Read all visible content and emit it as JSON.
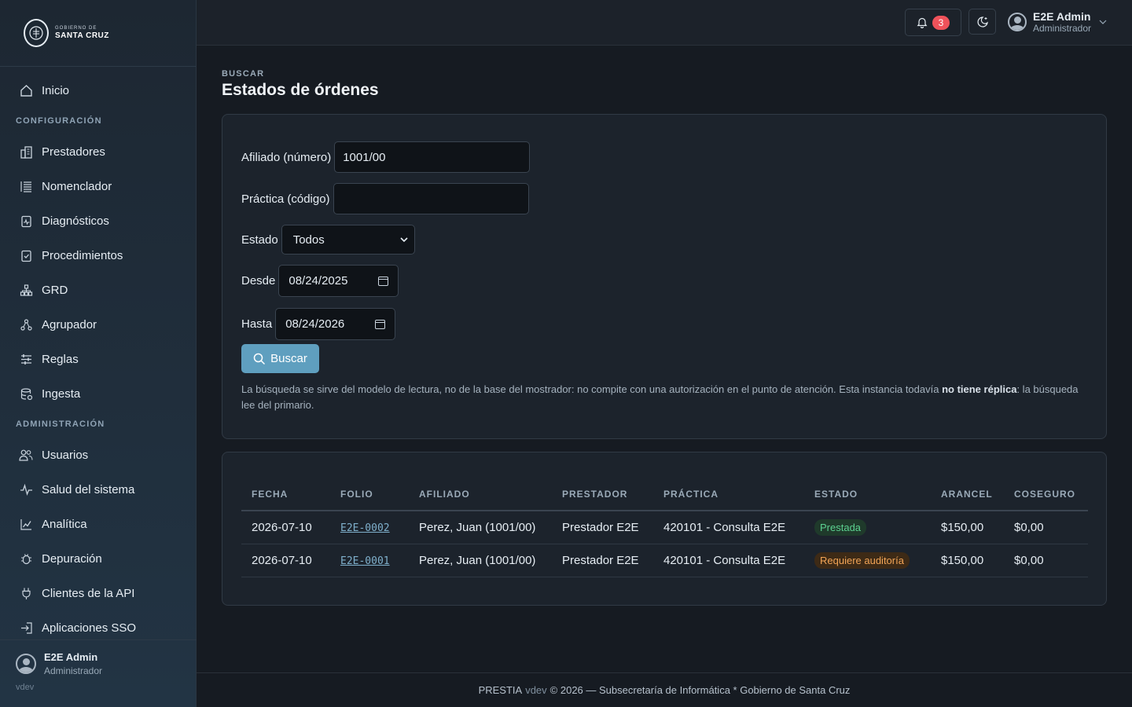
{
  "brand": {
    "logo_small": "GOBIERNO DE",
    "logo_big": "SANTA CRUZ"
  },
  "sidebar": {
    "home": "Inicio",
    "section_config": "CONFIGURACIÓN",
    "config_items": [
      {
        "label": "Prestadores",
        "icon": "building-icon"
      },
      {
        "label": "Nomenclador",
        "icon": "list-icon"
      },
      {
        "label": "Diagnósticos",
        "icon": "clipboard-pulse-icon"
      },
      {
        "label": "Procedimientos",
        "icon": "clipboard-check-icon"
      },
      {
        "label": "GRD",
        "icon": "hierarchy-icon"
      },
      {
        "label": "Agrupador",
        "icon": "nodes-icon"
      },
      {
        "label": "Reglas",
        "icon": "sliders-icon"
      },
      {
        "label": "Ingesta",
        "icon": "database-icon"
      }
    ],
    "section_admin": "ADMINISTRACIÓN",
    "admin_items": [
      {
        "label": "Usuarios",
        "icon": "users-icon"
      },
      {
        "label": "Salud del sistema",
        "icon": "activity-icon"
      },
      {
        "label": "Analítica",
        "icon": "chart-line-icon"
      },
      {
        "label": "Depuración",
        "icon": "bug-icon"
      },
      {
        "label": "Clientes de la API",
        "icon": "plug-icon"
      },
      {
        "label": "Aplicaciones SSO",
        "icon": "login-icon"
      }
    ],
    "user_name": "E2E Admin",
    "user_role": "Administrador",
    "version": "vdev"
  },
  "topbar": {
    "notification_count": "3",
    "user_name": "E2E Admin",
    "user_role": "Administrador"
  },
  "page": {
    "eyebrow": "BUSCAR",
    "title": "Estados de órdenes"
  },
  "form": {
    "afiliado_label": "Afiliado (número)",
    "afiliado_value": "1001/00",
    "practica_label": "Práctica (código)",
    "practica_value": "",
    "estado_label": "Estado",
    "estado_value": "Todos",
    "desde_label": "Desde",
    "desde_value": "08/24/2025",
    "hasta_label": "Hasta",
    "hasta_value": "08/24/2026",
    "buscar_label": "Buscar",
    "help_text_1": "La búsqueda se sirve del modelo de lectura, no de la base del mostrador: no compite con una autorización en el punto de atención. Esta instancia todavía ",
    "help_strong": "no tiene réplica",
    "help_text_2": ": la búsqueda lee del primario."
  },
  "table": {
    "columns": [
      "FECHA",
      "FOLIO",
      "AFILIADO",
      "PRESTADOR",
      "PRÁCTICA",
      "ESTADO",
      "ARANCEL",
      "COSEGURO"
    ],
    "rows": [
      {
        "fecha": "2026-07-10",
        "folio": "E2E-0002",
        "afiliado": "Perez, Juan (1001/00)",
        "prestador": "Prestador E2E",
        "practica": "420101 - Consulta E2E",
        "estado": "Prestada",
        "arancel": "$150,00",
        "coseguro": "$0,00"
      },
      {
        "fecha": "2026-07-10",
        "folio": "E2E-0001",
        "afiliado": "Perez, Juan (1001/00)",
        "prestador": "Prestador E2E",
        "practica": "420101 - Consulta E2E",
        "estado": "Requiere auditoría",
        "arancel": "$150,00",
        "coseguro": "$0,00"
      }
    ]
  },
  "footer": {
    "app": "PRESTIA",
    "version": "vdev",
    "text": "© 2026 — Subsecretaría de Informática * Gobierno de Santa Cruz"
  },
  "colors": {
    "accent": "#5f9fbf",
    "badge": "#f0525a",
    "status_ok": "#5cd190",
    "status_warn": "#f2a456"
  }
}
